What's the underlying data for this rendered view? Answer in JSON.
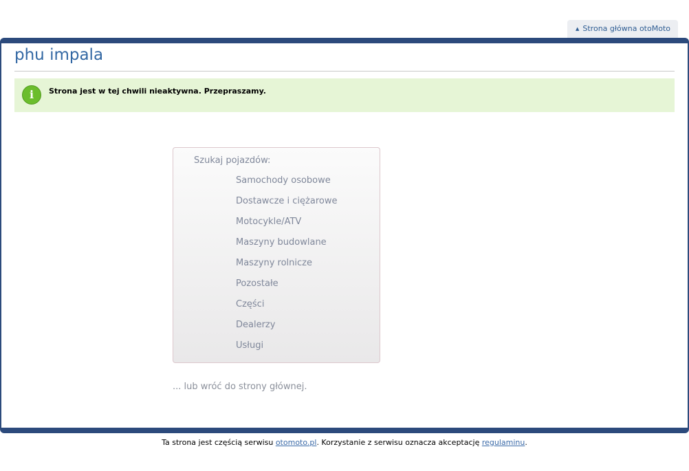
{
  "header": {
    "home_link": "Strona główna otoMoto",
    "home_link_icon": "up-arrow-icon"
  },
  "page": {
    "title": "phu impala"
  },
  "notice": {
    "icon": "info-icon",
    "icon_glyph": "i",
    "text": "Strona jest w tej chwili nieaktywna. Przepraszamy."
  },
  "search": {
    "heading": "Szukaj pojazdów:",
    "categories": [
      "Samochody osobowe",
      "Dostawcze i ciężarowe",
      "Motocykle/ATV",
      "Maszyny budowlane",
      "Maszyny rolnicze",
      "Pozostałe",
      "Części",
      "Dealerzy",
      "Usługi"
    ]
  },
  "back_link": "... lub wróć do strony głównej.",
  "footer": {
    "prefix": "Ta strona jest częścią serwisu ",
    "site_link": "otomoto.pl",
    "middle": ". Korzystanie z serwisu oznacza akceptację ",
    "terms_link": "regulaminu",
    "suffix": "."
  },
  "colors": {
    "frame": "#2c4a7c",
    "title": "#3267a3",
    "notice_bg": "#e6f5d6",
    "link": "#3a6aa8"
  }
}
